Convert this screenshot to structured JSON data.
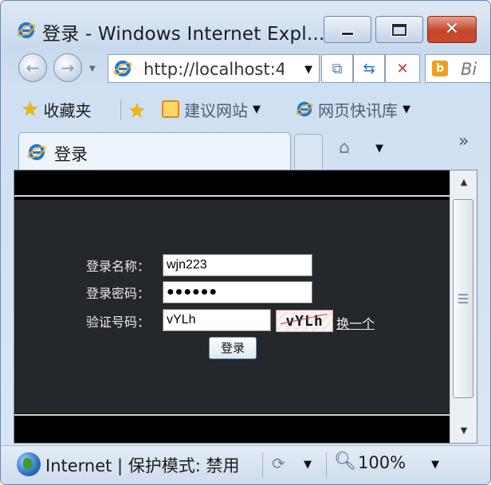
{
  "window": {
    "title": "登录 - Windows Internet Expl..."
  },
  "address": {
    "url": "http://localhost:4",
    "search_placeholder": "Bi"
  },
  "favorites": {
    "label": "收藏夹",
    "items": [
      "建议网站",
      "网页快讯库"
    ]
  },
  "tabs": {
    "active_label": "登录"
  },
  "form": {
    "username_label": "登录名称：",
    "username_value": "wjn223",
    "password_label": "登录密码：",
    "password_value": "●●●●●●",
    "captcha_label": "验证号码：",
    "captcha_value": "vYLh",
    "captcha_image_text": "vYLh",
    "change_link": "换一个",
    "submit_label": "登录"
  },
  "status": {
    "zone_text": "Internet | 保护模式: 禁用",
    "zoom": "100%"
  },
  "colors": {
    "page_background": "#24272b",
    "band": "#000000",
    "close_button": "#c4452a"
  }
}
